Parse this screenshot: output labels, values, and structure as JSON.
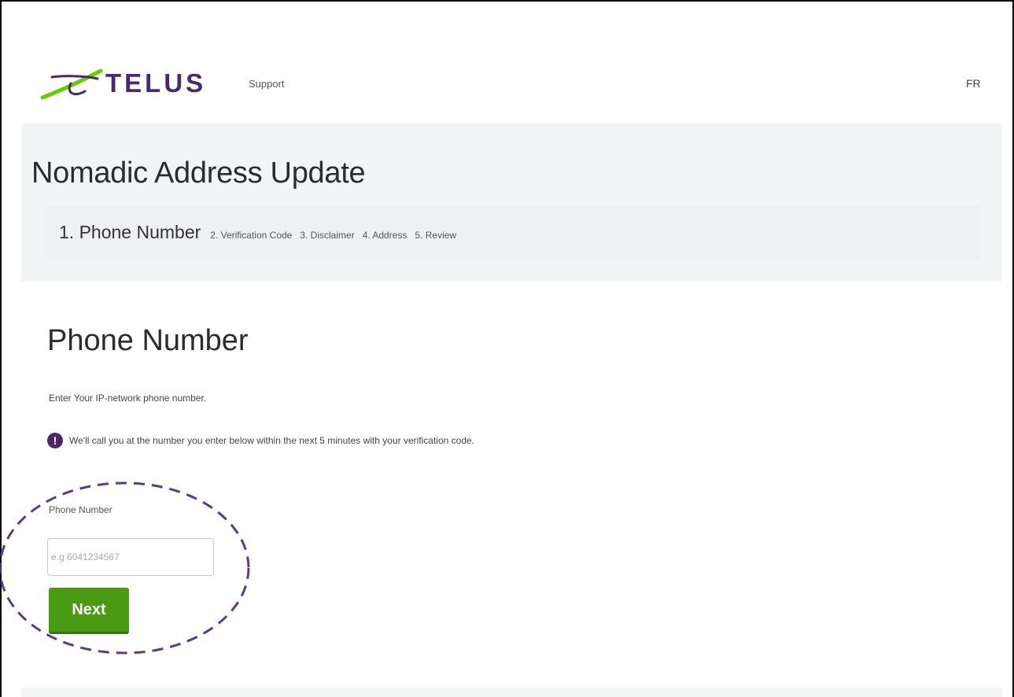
{
  "header": {
    "brand": "TELUS",
    "support_label": "Support",
    "language_label": "FR"
  },
  "hero": {
    "title": "Nomadic Address Update",
    "steps": [
      {
        "label": "1. Phone Number",
        "active": true
      },
      {
        "label": "2. Verification Code",
        "active": false
      },
      {
        "label": "3. Disclaimer",
        "active": false
      },
      {
        "label": "4. Address",
        "active": false
      },
      {
        "label": "5. Review",
        "active": false
      }
    ]
  },
  "main": {
    "title": "Phone Number",
    "intro": "Enter Your IP-network phone number.",
    "notice": {
      "icon": "exclamation-icon",
      "text": "We'll call you at the number you enter below within the next 5 minutes with your verification code."
    },
    "phone_field": {
      "label": "Phone Number",
      "value": "",
      "placeholder": "e.g 6041234567"
    },
    "next_label": "Next"
  },
  "colors": {
    "brand_purple": "#4b286d",
    "brand_green": "#66cc00",
    "button_green": "#4b9a13",
    "hero_bg": "#f2f4f6",
    "annotation_ring": "#5b3a8c"
  }
}
